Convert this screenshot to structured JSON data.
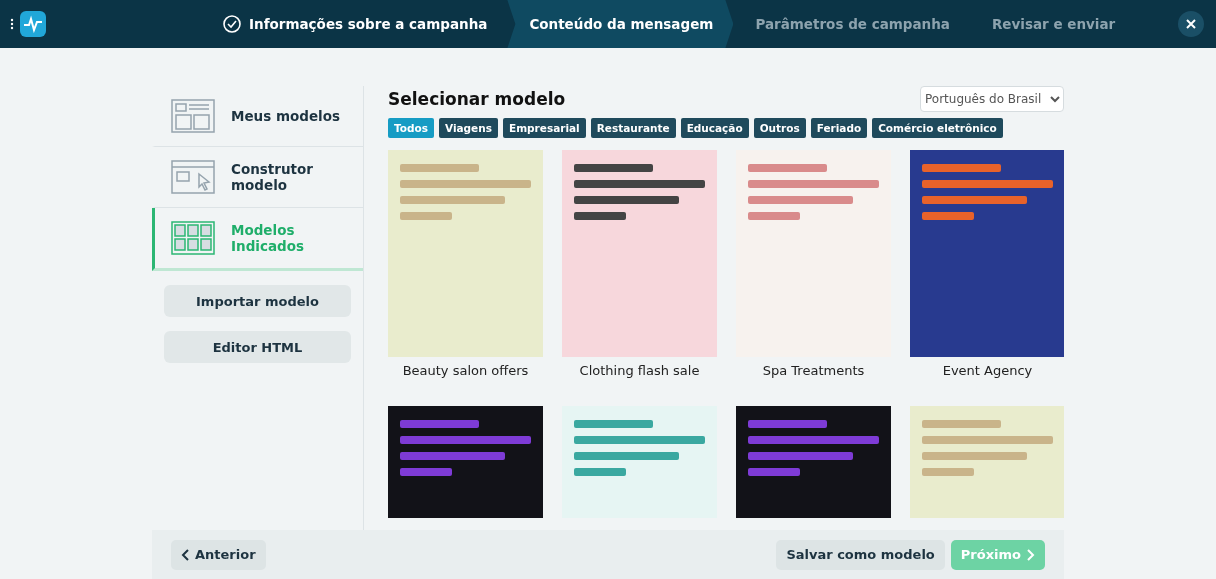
{
  "steps": [
    {
      "label": "Informações sobre a campanha",
      "selected": false,
      "completed": true
    },
    {
      "label": "Conteúdo da mensagem",
      "selected": true,
      "completed": false
    },
    {
      "label": "Parâmetros de campanha",
      "selected": false,
      "completed": false
    },
    {
      "label": "Revisar e enviar",
      "selected": false,
      "completed": false
    }
  ],
  "sidebar": {
    "items": [
      {
        "label": "Meus modelos",
        "kind": "list",
        "selected": false
      },
      {
        "label": "Construtor modelo",
        "kind": "builder",
        "selected": false
      },
      {
        "label": "Modelos Indicados",
        "kind": "grid",
        "selected": true
      }
    ],
    "buttons": [
      "Importar modelo",
      "Editor HTML"
    ]
  },
  "title": "Selecionar modelo",
  "language": {
    "value": "Português do Brasil"
  },
  "filters": [
    {
      "label": "Todos",
      "selected": true
    },
    {
      "label": "Viagens",
      "selected": false
    },
    {
      "label": "Empresarial",
      "selected": false
    },
    {
      "label": "Restaurante",
      "selected": false
    },
    {
      "label": "Educação",
      "selected": false
    },
    {
      "label": "Outros",
      "selected": false
    },
    {
      "label": "Feriado",
      "selected": false
    },
    {
      "label": "Comércio eletrônico",
      "selected": false
    }
  ],
  "templates": [
    {
      "name": "Beauty salon offers",
      "kind": "cream"
    },
    {
      "name": "Clothing flash sale",
      "kind": "pink"
    },
    {
      "name": "Spa Treatments",
      "kind": "spa"
    },
    {
      "name": "Event Agency",
      "kind": "navy"
    },
    {
      "kind": "dark"
    },
    {
      "kind": "mint"
    },
    {
      "kind": "dark"
    },
    {
      "kind": "cream"
    }
  ],
  "footer": {
    "back": "Anterior",
    "save": "Salvar como modelo",
    "next": "Próximo"
  }
}
